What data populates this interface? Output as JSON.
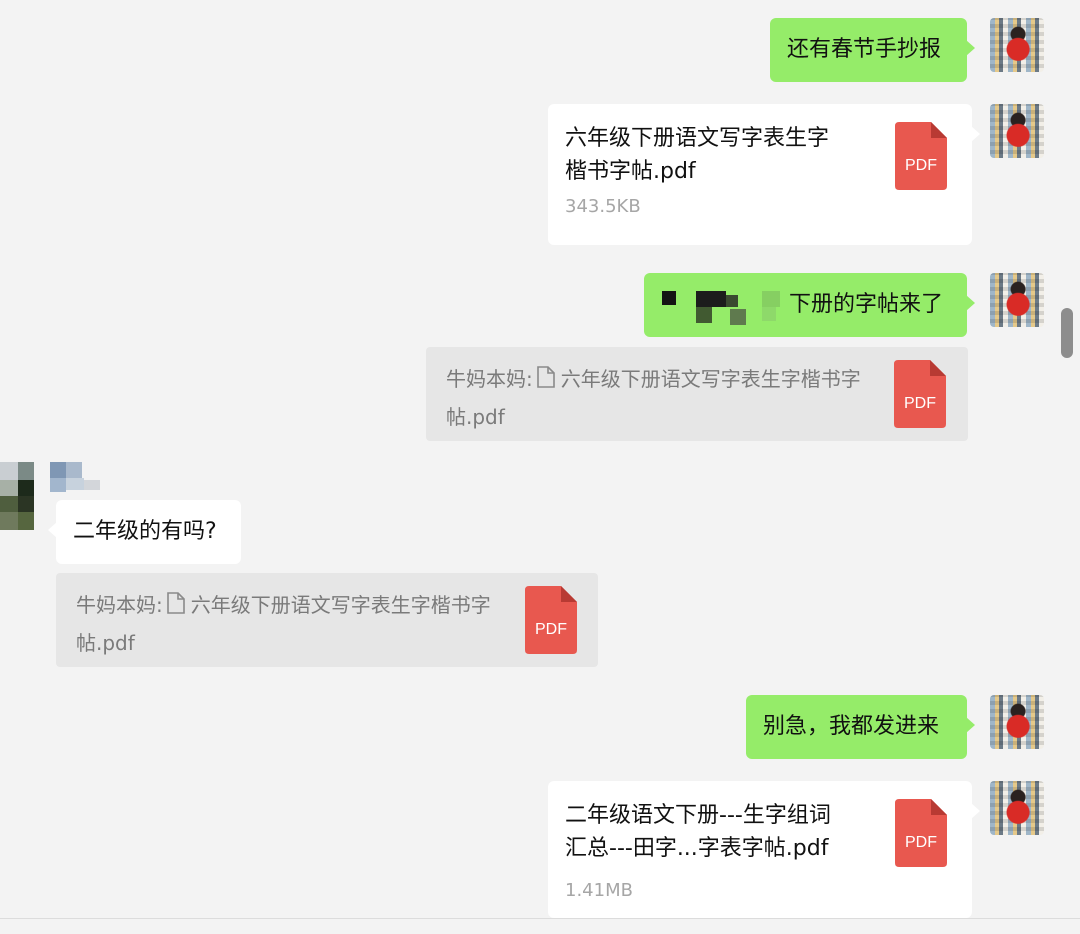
{
  "messages": {
    "m1": {
      "text": "还有春节手抄报"
    },
    "m2": {
      "file_name_line1": "六年级下册语文写字表生字",
      "file_name_line2": "楷书字帖.pdf",
      "size": "343.5KB",
      "icon": "PDF"
    },
    "m3": {
      "text": "下册的字帖来了"
    },
    "m4": {
      "sender": "牛妈本妈:",
      "line1": "六年级下册语文写字表生字楷书字",
      "line2": "帖.pdf",
      "icon": "PDF"
    },
    "m5": {
      "text": "二年级的有吗?"
    },
    "m6": {
      "sender": "牛妈本妈:",
      "line1": "六年级下册语文写字表生字楷书字",
      "line2": "帖.pdf",
      "icon": "PDF"
    },
    "m7": {
      "text": "别急，我都发进来"
    },
    "m8": {
      "file_name_line1": "二年级语文下册---生字组词",
      "file_name_line2": "汇总---田字...字表字帖.pdf",
      "size": "1.41MB",
      "icon": "PDF"
    }
  },
  "colors": {
    "self_bubble": "#95ec69",
    "other_bubble": "#ffffff",
    "quote_bg": "#e6e6e6",
    "pdf_red": "#e8584f",
    "background": "#f3f3f3"
  },
  "icons": [
    "pdf-file-icon",
    "document-icon",
    "user-avatar"
  ]
}
